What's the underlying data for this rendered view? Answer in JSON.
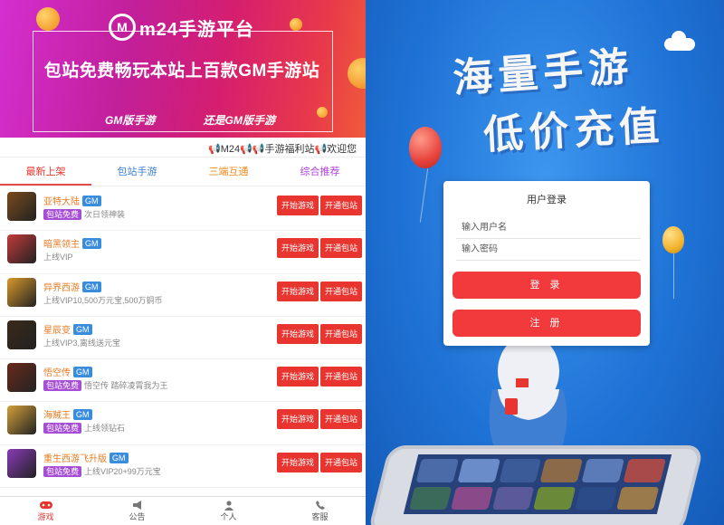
{
  "left": {
    "banner": {
      "logo_text": "m24手游平台",
      "logo_mark": "M",
      "headline": "包站免费畅玩本站上百款GM手游站",
      "tags": [
        "GM版手游",
        "还是GM版手游"
      ]
    },
    "marquee": "📢M24📢📢手游福利站📢欢迎您",
    "tabs": [
      {
        "label": "最新上架",
        "color": "#e8352f"
      },
      {
        "label": "包站手游",
        "color": "#3a7fd6"
      },
      {
        "label": "三端互通",
        "color": "#f08a1a"
      },
      {
        "label": "综合推荐",
        "color": "#b040d8"
      }
    ],
    "games": [
      {
        "name": "亚特大陆",
        "gm": "GM",
        "pkg": "包站免费",
        "desc": "次日领神装",
        "thumb": "#7a4a1c"
      },
      {
        "name": "暗黑领主",
        "gm": "GM",
        "pkg": "",
        "desc": "上线VIP",
        "thumb": "#c23a3a"
      },
      {
        "name": "异界西游",
        "gm": "GM",
        "pkg": "",
        "desc": "上线VIP10,500万元宝,500万铜币",
        "thumb": "#d89a2a"
      },
      {
        "name": "星辰变",
        "gm": "GM",
        "pkg": "",
        "desc": "上线VIP3,离线送元宝",
        "thumb": "#3a2a1a"
      },
      {
        "name": "悟空传",
        "gm": "GM",
        "pkg": "包站免费",
        "desc": "悟空传 踏碎凌霄我为王",
        "thumb": "#6a2a1a"
      },
      {
        "name": "海贼王",
        "gm": "GM",
        "pkg": "包站免费",
        "desc": "上线领钻石",
        "thumb": "#d2a03a"
      },
      {
        "name": "重生西游飞升版",
        "gm": "GM",
        "pkg": "包站免费",
        "desc": "上线VIP20+99万元宝",
        "thumb": "#8a3ab8"
      }
    ],
    "btn_start": "开始游戏",
    "btn_open": "开通包站",
    "tabbar": [
      {
        "label": "游戏",
        "icon": "gamepad-icon",
        "active": true
      },
      {
        "label": "公告",
        "icon": "megaphone-icon",
        "active": false
      },
      {
        "label": "个人",
        "icon": "person-icon",
        "active": false
      },
      {
        "label": "客服",
        "icon": "phone-icon",
        "active": false
      }
    ],
    "colors": {
      "accent": "#e8352f",
      "gm_badge": "#3a8ddc",
      "pkg_badge": "#a64fd6",
      "game_name": "#e87a20"
    }
  },
  "right": {
    "hero_line1": "海量手游",
    "hero_line2": "低价充值",
    "login": {
      "title": "用户登录",
      "username_placeholder": "输入用户名",
      "password_placeholder": "输入密码",
      "login_label": "登 录",
      "register_label": "注 册"
    },
    "colors": {
      "background": "#1f73d6",
      "button": "#f23a3c"
    }
  }
}
